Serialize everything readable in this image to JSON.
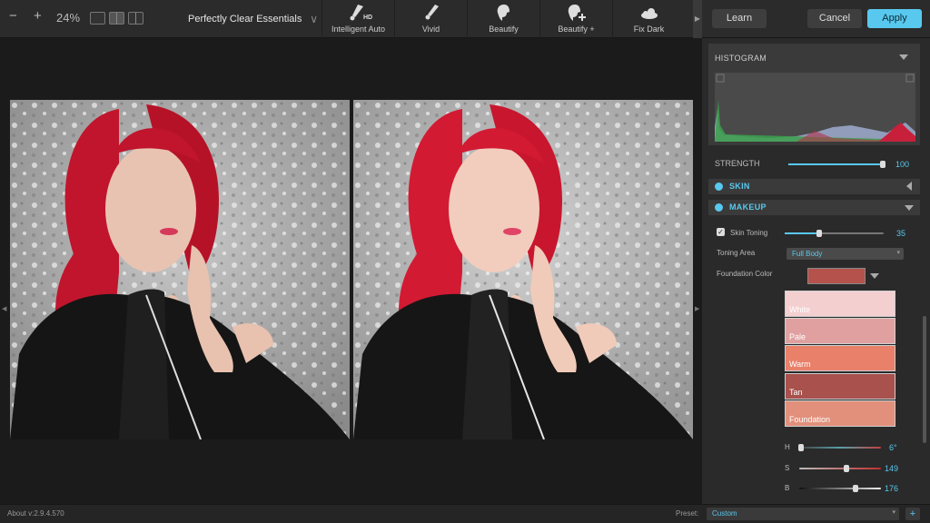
{
  "toolbar": {
    "zoom_out": "−",
    "zoom_in": "+",
    "zoom_level": "24%",
    "preset_name": "Perfectly Clear Essentials",
    "tools": [
      {
        "label": "Intelligent Auto",
        "icon": "brush-hd-icon"
      },
      {
        "label": "Vivid",
        "icon": "brush-icon"
      },
      {
        "label": "Beautify",
        "icon": "face-icon"
      },
      {
        "label": "Beautify +",
        "icon": "face-plus-icon"
      },
      {
        "label": "Fix Dark",
        "icon": "cloud-icon"
      }
    ],
    "hd_badge": "HD",
    "learn": "Learn",
    "cancel": "Cancel",
    "apply": "Apply"
  },
  "panel": {
    "histogram_title": "HISTOGRAM",
    "strength_label": "STRENGTH",
    "strength_value": "100",
    "strength_fraction": 0.98,
    "skin_title": "SKIN",
    "makeup_title": "MAKEUP",
    "skin_toning_label": "Skin Toning",
    "skin_toning_value": "35",
    "skin_toning_fraction": 0.35,
    "toning_area_label": "Toning Area",
    "toning_area_value": "Full Body",
    "foundation_label": "Foundation Color",
    "foundation_color": "#b5524b",
    "swatches": [
      {
        "name": "White",
        "color": "#f4cfd0"
      },
      {
        "name": "Pale",
        "color": "#e1a0a0"
      },
      {
        "name": "Warm",
        "color": "#e8806a"
      },
      {
        "name": "Tan",
        "color": "#a8514d"
      },
      {
        "name": "Foundation",
        "color": "#e2907c"
      }
    ],
    "h_label": "H",
    "h_value": "6°",
    "h_fraction": 0.02,
    "s_label": "S",
    "s_value": "149",
    "s_fraction": 0.58,
    "b_label": "B",
    "b_value": "176",
    "b_fraction": 0.69
  },
  "status": {
    "about": "About v:2.9.4.570",
    "preset_label": "Preset:",
    "preset_value": "Custom",
    "add": "+"
  },
  "colors": {
    "accent": "#58c8ee"
  }
}
